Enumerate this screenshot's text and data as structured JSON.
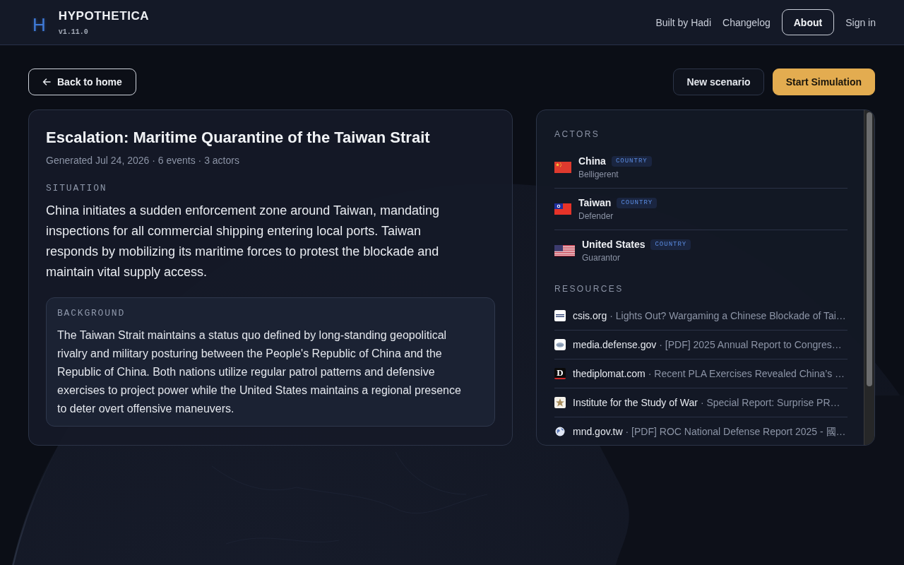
{
  "header": {
    "logo": {
      "mark": "H",
      "name": "HYPOTHETICA",
      "version": "v1.11.0"
    },
    "nav": [
      {
        "label": "Built by Hadi",
        "kind": "link"
      },
      {
        "label": "Changelog",
        "kind": "link"
      },
      {
        "label": "About",
        "kind": "outlined"
      },
      {
        "label": "Sign in",
        "kind": "link"
      }
    ]
  },
  "toolbar": {
    "back": {
      "label": "Back to home"
    },
    "actions": [
      {
        "label": "New scenario",
        "kind": "secondary"
      },
      {
        "label": "Start Simulation",
        "kind": "primary"
      }
    ]
  },
  "scenario": {
    "title": "Escalation: Maritime Quarantine of the Taiwan Strait",
    "meta": "Generated Jul 24, 2026 · 6 events · 3 actors",
    "situation": {
      "heading": "SITUATION",
      "text": "China initiates a sudden enforcement zone around Taiwan, mandating inspections for all commercial shipping entering local ports. Taiwan responds by mobilizing its maritime forces to protest the blockade and maintain vital supply access."
    },
    "background": {
      "heading": "BACKGROUND",
      "text": "The Taiwan Strait maintains a status quo defined by long-standing geopolitical rivalry and military posturing between the People's Republic of China and the Republic of China. Both nations utilize regular patrol patterns and defensive exercises to project power while the United States maintains a regional presence to deter overt offensive maneuvers."
    }
  },
  "sidebar": {
    "actors": {
      "heading": "ACTORS",
      "items": [
        {
          "name": "China",
          "badge": "COUNTRY",
          "role": "Belligerent",
          "kind": "cn"
        },
        {
          "name": "Taiwan",
          "badge": "COUNTRY",
          "role": "Defender",
          "kind": "tw"
        },
        {
          "name": "United States",
          "badge": "COUNTRY",
          "role": "Guarantor",
          "kind": "us"
        }
      ]
    },
    "resources": {
      "heading": "RESOURCES",
      "items": [
        {
          "source": "csis.org",
          "title": "· Lights Out? Wargaming a Chinese Blockade of Tai…",
          "kind": "wordmark"
        },
        {
          "source": "media.defense.gov",
          "title": "· [PDF] 2025 Annual Report to Congres…",
          "kind": "seal"
        },
        {
          "source": "thediplomat.com",
          "title": "· Recent PLA Exercises Revealed China’s …",
          "kind": "letter",
          "icon_text": "D"
        },
        {
          "source": "Institute for the Study of War",
          "title": "· Special Report: Surprise PR…",
          "kind": "star"
        },
        {
          "source": "mnd.gov.tw",
          "title": "· [PDF] ROC National Defense Report 2025 - 國…",
          "kind": "globe"
        }
      ]
    }
  }
}
